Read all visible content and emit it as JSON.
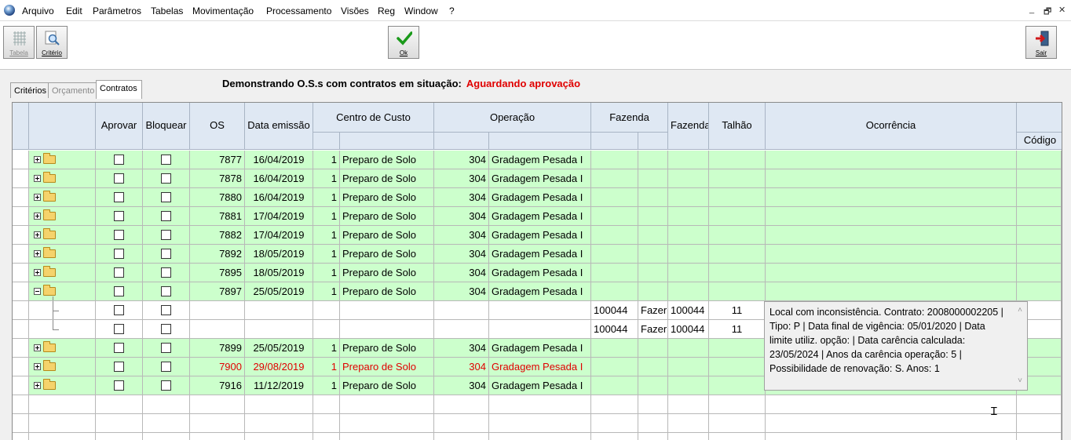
{
  "menu": {
    "items": [
      "Arquivo",
      "Edit",
      "Parâmetros",
      "Tabelas",
      "Movimentação",
      "Processamento",
      "Visões",
      "Reg",
      "Window",
      "?"
    ],
    "window_controls": [
      "_",
      "🗗",
      "✕"
    ]
  },
  "toolbar": {
    "tabela_label": "Tabela",
    "criterio_label": "Critério",
    "ok_label": "Ok",
    "sair_label": "Sair"
  },
  "tabs": [
    "Critérios",
    "Orçamento",
    "Contratos"
  ],
  "heading": {
    "text": "Demonstrando O.S.s com contratos em situação:",
    "status": "Aguardando aprovação",
    "status_color": "#e00000"
  },
  "grid": {
    "headers": {
      "aprovar": "Aprovar",
      "bloquear": "Bloquear",
      "os": "OS",
      "data_emissao": "Data emissão",
      "centro_custo": "Centro de Custo",
      "operacao": "Operação",
      "fazenda": "Fazenda",
      "fazenda2": "Fazenda",
      "talhao": "Talhão",
      "ocorrencia": "Ocorrência",
      "codigo": "Código"
    },
    "colors": {
      "row_green": "#ccffcc",
      "highlight_red": "#e00000",
      "child_white": "#ffffff"
    },
    "rows": [
      {
        "type": "parent",
        "expanded": false,
        "os": "7877",
        "data": "16/04/2019",
        "cc_cod": "1",
        "cc_nome": "Preparo de Solo",
        "op_cod": "304",
        "op_nome": "Gradagem Pesada I",
        "red": false
      },
      {
        "type": "parent",
        "expanded": false,
        "os": "7878",
        "data": "16/04/2019",
        "cc_cod": "1",
        "cc_nome": "Preparo de Solo",
        "op_cod": "304",
        "op_nome": "Gradagem Pesada I",
        "red": false
      },
      {
        "type": "parent",
        "expanded": false,
        "os": "7880",
        "data": "16/04/2019",
        "cc_cod": "1",
        "cc_nome": "Preparo de Solo",
        "op_cod": "304",
        "op_nome": "Gradagem Pesada I",
        "red": false
      },
      {
        "type": "parent",
        "expanded": false,
        "os": "7881",
        "data": "17/04/2019",
        "cc_cod": "1",
        "cc_nome": "Preparo de Solo",
        "op_cod": "304",
        "op_nome": "Gradagem Pesada I",
        "red": false
      },
      {
        "type": "parent",
        "expanded": false,
        "os": "7882",
        "data": "17/04/2019",
        "cc_cod": "1",
        "cc_nome": "Preparo de Solo",
        "op_cod": "304",
        "op_nome": "Gradagem Pesada I",
        "red": false
      },
      {
        "type": "parent",
        "expanded": false,
        "os": "7892",
        "data": "18/05/2019",
        "cc_cod": "1",
        "cc_nome": "Preparo de Solo",
        "op_cod": "304",
        "op_nome": "Gradagem Pesada I",
        "red": false
      },
      {
        "type": "parent",
        "expanded": false,
        "os": "7895",
        "data": "18/05/2019",
        "cc_cod": "1",
        "cc_nome": "Preparo de Solo",
        "op_cod": "304",
        "op_nome": "Gradagem Pesada I",
        "red": false
      },
      {
        "type": "parent",
        "expanded": true,
        "os": "7897",
        "data": "25/05/2019",
        "cc_cod": "1",
        "cc_nome": "Preparo de Solo",
        "op_cod": "304",
        "op_nome": "Gradagem Pesada I",
        "red": false
      },
      {
        "type": "child",
        "faz_cod": "100044",
        "faz_nome": "Fazer",
        "faz2": "100044",
        "talhao": "11"
      },
      {
        "type": "child",
        "faz_cod": "100044",
        "faz_nome": "Fazer",
        "faz2": "100044",
        "talhao": "11"
      },
      {
        "type": "parent",
        "expanded": false,
        "os": "7899",
        "data": "25/05/2019",
        "cc_cod": "1",
        "cc_nome": "Preparo de Solo",
        "op_cod": "304",
        "op_nome": "Gradagem Pesada I",
        "red": false
      },
      {
        "type": "parent",
        "expanded": false,
        "os": "7900",
        "data": "29/08/2019",
        "cc_cod": "1",
        "cc_nome": "Preparo de Solo",
        "op_cod": "304",
        "op_nome": "Gradagem Pesada I",
        "red": true
      },
      {
        "type": "parent",
        "expanded": false,
        "os": "7916",
        "data": "11/12/2019",
        "cc_cod": "1",
        "cc_nome": "Preparo de Solo",
        "op_cod": "304",
        "op_nome": "Gradagem Pesada I",
        "red": false
      },
      {
        "type": "empty"
      },
      {
        "type": "empty"
      },
      {
        "type": "empty"
      }
    ]
  },
  "tooltip": {
    "text": "Local com inconsistência. Contrato: 2008000002205 | Tipo: P | Data final de vigência: 05/01/2020 | Data limite utiliz. opção:  | Data carência calculada: 23/05/2024 | Anos da carência operação: 5 | Possibilidade de renovação: S. Anos: 1"
  }
}
